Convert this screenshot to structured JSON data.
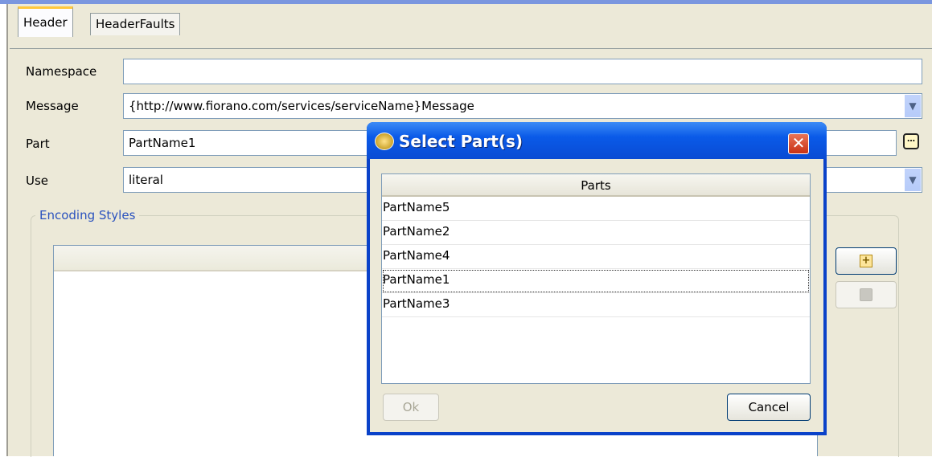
{
  "tabs": [
    "Header",
    "HeaderFaults"
  ],
  "form": {
    "namespace_label": "Namespace",
    "namespace_value": "",
    "message_label": "Message",
    "message_value": "{http://www.fiorano.com/services/serviceName}Message",
    "part_label": "Part",
    "part_value": "PartName1",
    "use_label": "Use",
    "use_value": "literal"
  },
  "encoding_styles": {
    "title": "Encoding Styles"
  },
  "dialog": {
    "title": "Select Part(s)",
    "column_header": "Parts",
    "rows": [
      "PartName5",
      "PartName2",
      "PartName4",
      "PartName1",
      "PartName3"
    ],
    "focused_row": "PartName1",
    "ok_label": "Ok",
    "cancel_label": "Cancel"
  },
  "colors": {
    "titlebar": "#0a5ae8",
    "dialog_bg": "#ece9d8",
    "group_title": "#2a52be",
    "tab_accent": "#ffc83c"
  }
}
